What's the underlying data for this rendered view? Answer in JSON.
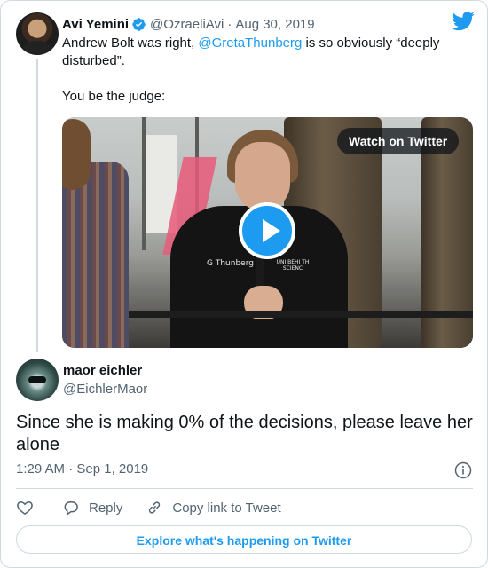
{
  "parent_tweet": {
    "author_name": "Avi Yemini",
    "handle": "@OzraeliAvi",
    "separator": "·",
    "date": "Aug 30, 2019",
    "text_before_mention": "Andrew Bolt was right, ",
    "mention": "@GretaThunberg",
    "text_after_mention": " is so obviously “deeply disturbed”.",
    "text_line2": "You be the judge:",
    "video": {
      "watch_label": "Watch on Twitter",
      "shirt_text": "G Thunberg",
      "sign_text": "UNI BEHI TH SCIENC"
    }
  },
  "reply_tweet": {
    "author_name": "maor eichler",
    "handle": "@EichlerMaor",
    "text": "Since she is making 0% of the decisions, please leave her alone",
    "timestamp": "1:29 AM · Sep 1, 2019"
  },
  "actions": {
    "reply_label": "Reply",
    "copy_label": "Copy link to Tweet"
  },
  "explore_label": "Explore what's happening on Twitter",
  "icons": [
    "verified-badge-icon",
    "twitter-bird-icon",
    "play-icon",
    "info-icon",
    "heart-icon",
    "reply-icon",
    "link-icon"
  ],
  "colors": {
    "accent": "#1d9bf0",
    "text": "#0f1419",
    "muted": "#536471",
    "border": "#cfd9de"
  }
}
